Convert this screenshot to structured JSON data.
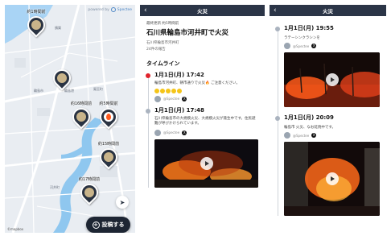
{
  "map": {
    "powered_by": "powered by",
    "powered_brand": "Spectee",
    "labels": [
      "鵠巣",
      "輪島市",
      "輪島港",
      "河井町",
      "鳳至町"
    ],
    "markers": [
      {
        "time": "約1時間前",
        "icon": "event-pin-icon"
      },
      {
        "time": "",
        "icon": "event-pin-icon"
      },
      {
        "time": "約16時間前",
        "icon": "event-pin-icon"
      },
      {
        "time": "約5時間前",
        "icon": "fire-pin-icon"
      },
      {
        "time": "約15時間前",
        "icon": "event-pin-icon"
      },
      {
        "time": "約17時間前",
        "icon": "event-pin-icon"
      }
    ],
    "post_button": "投稿する",
    "attribution": "©mapbox"
  },
  "detail": {
    "header_title": "火災",
    "updated": "最終更新 約5時間前",
    "title": "石川県輪島市河井町で火災",
    "location": "石川県輪島市河井町",
    "report_count": "24件の報告",
    "timeline_heading": "タイムライン",
    "entries": [
      {
        "time": "1月1日(月) 17:42",
        "body": "輪島市河井町、朝市通りで火災🔥 ご注意ください。",
        "source": "@Spectee",
        "color": "#e0232c"
      },
      {
        "time": "1月1日(月) 17:48",
        "body": "石川県輪島市の大規模火災、大規模火災が発生中です。住民避難が呼びかけられています。",
        "source": "@Spectee"
      }
    ]
  },
  "timeline2": {
    "header_title": "火災",
    "entries": [
      {
        "time": "1月1日(月) 19:55",
        "caption": "ラテーシンクラシンを",
        "source": "@Spectee"
      },
      {
        "time": "1月1日(月) 20:09",
        "caption": "輪島市 火災、なお延焼中です。",
        "source": "@Spectee"
      }
    ]
  }
}
